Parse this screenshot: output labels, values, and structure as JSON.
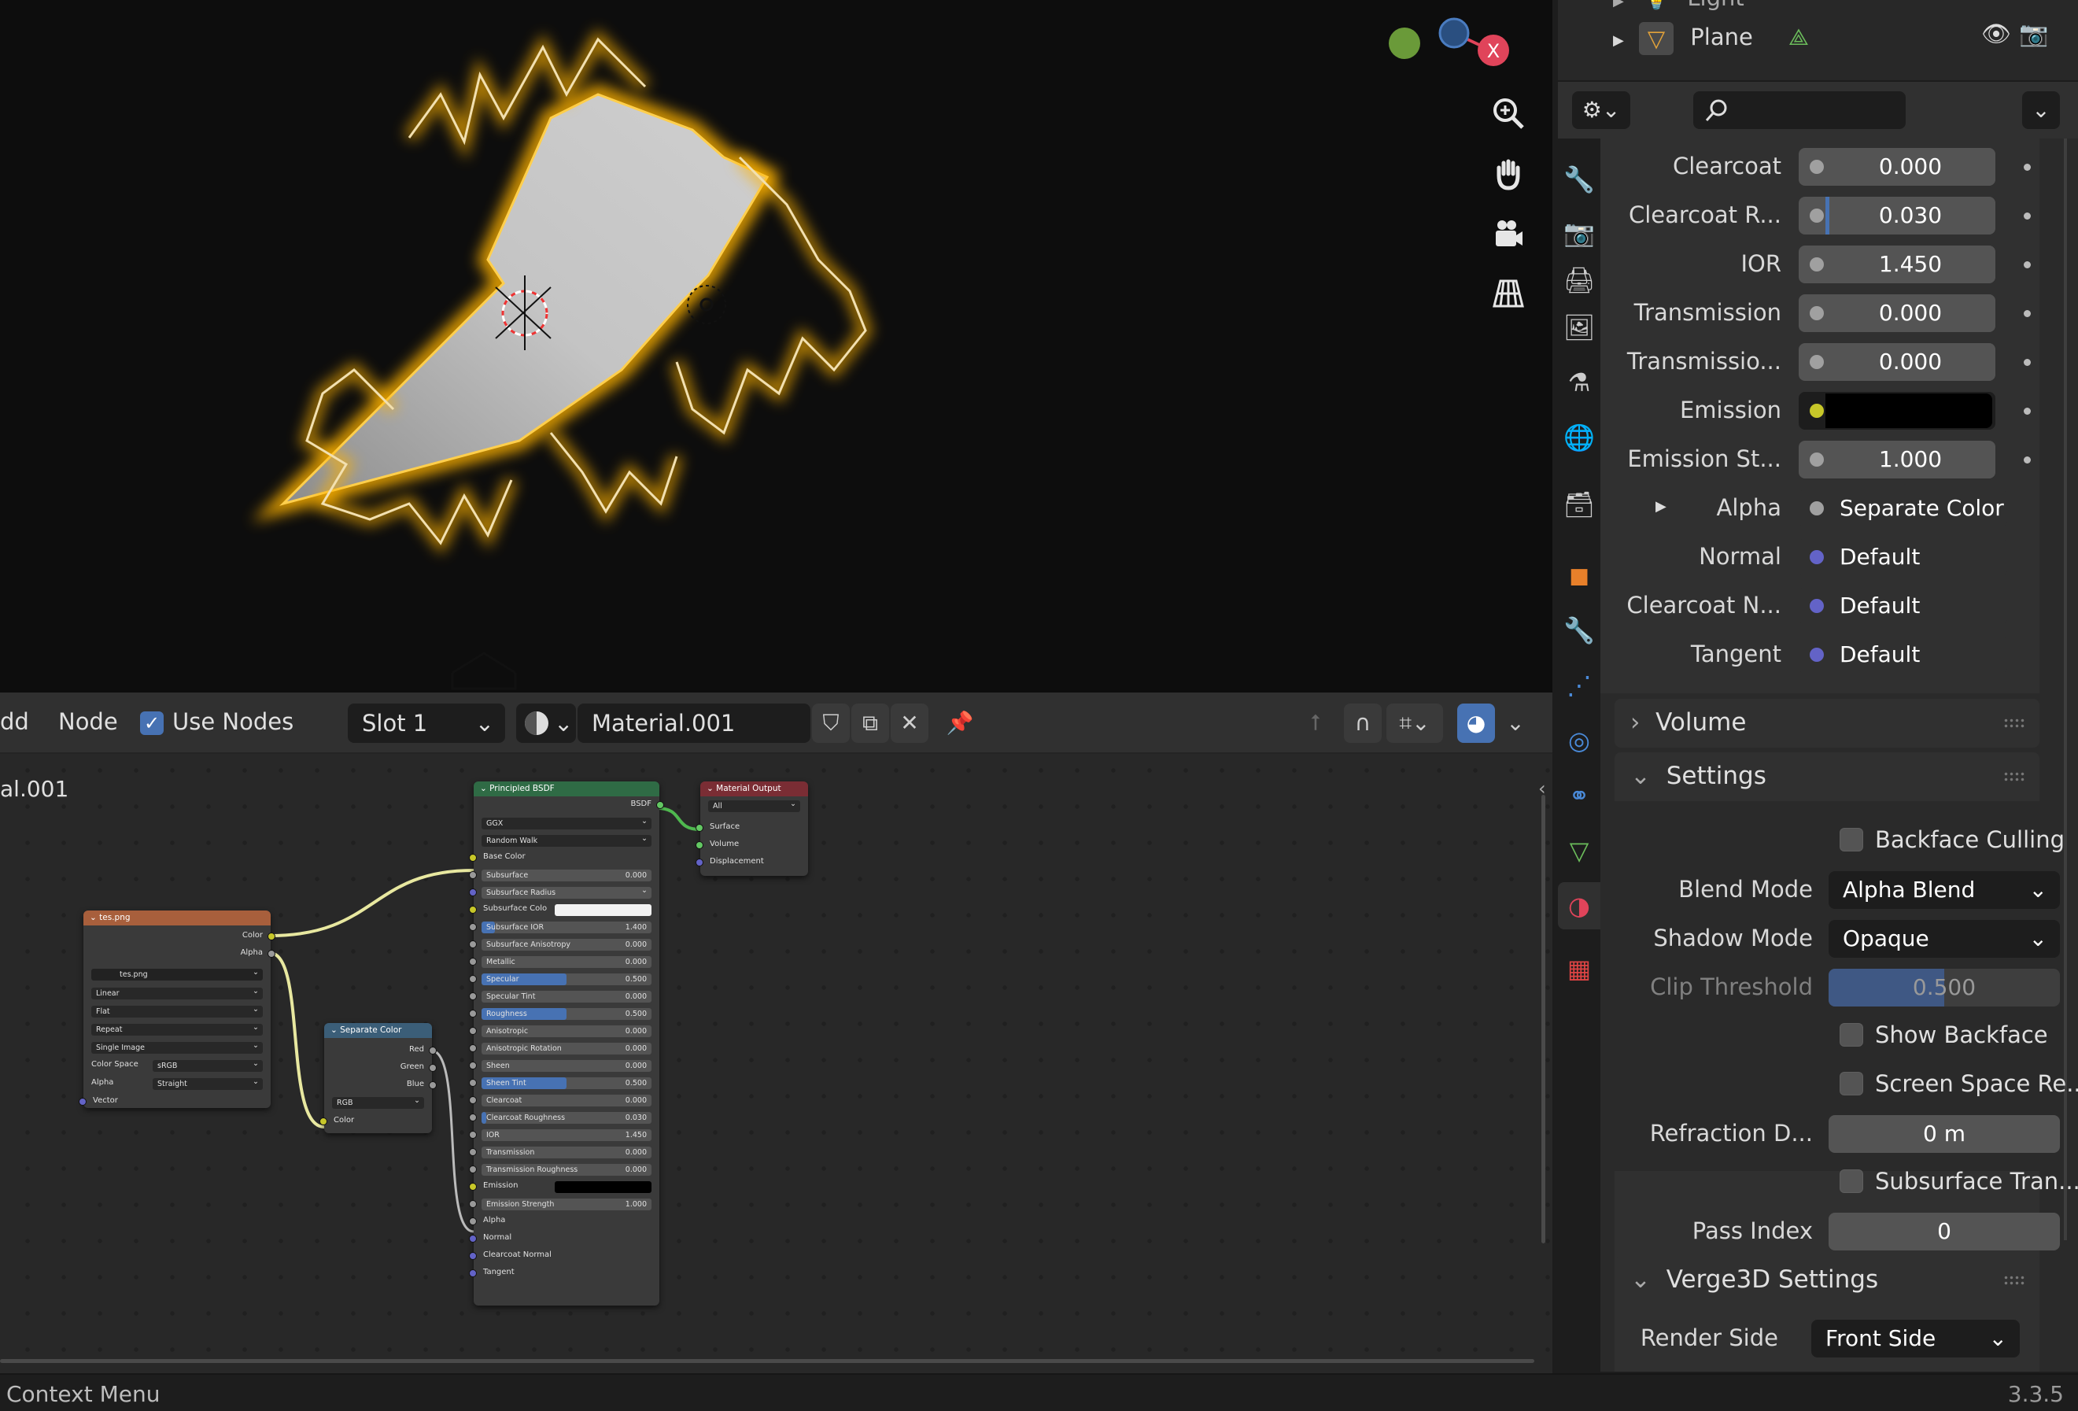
{
  "viewport": {
    "gizmo": {
      "x_label": "X"
    },
    "nav_buttons": [
      "zoom-icon",
      "hand-pan-icon",
      "camera-icon",
      "grid-perspective-icon"
    ]
  },
  "node_editor": {
    "header": {
      "add_menu": "dd",
      "node_menu": "Node",
      "use_nodes_label": "Use Nodes",
      "slot": "Slot 1",
      "material_name": "Material.001"
    },
    "breadcrumb": "al.001",
    "image_node": {
      "title": "tes.png",
      "out_color": "Color",
      "out_alpha": "Alpha",
      "image_name": "tes.png",
      "interpolation": "Linear",
      "projection": "Flat",
      "extension": "Repeat",
      "source": "Single Image",
      "color_space_label": "Color Space",
      "color_space": "sRGB",
      "alpha_label": "Alpha",
      "alpha_mode": "Straight",
      "in_vector": "Vector"
    },
    "separate_node": {
      "title": "Separate Color",
      "out_red": "Red",
      "out_green": "Green",
      "out_blue": "Blue",
      "mode": "RGB",
      "in_color": "Color"
    },
    "bsdf_node": {
      "title": "Principled BSDF",
      "out_bsdf": "BSDF",
      "distribution": "GGX",
      "subsurface_method": "Random Walk",
      "base_color": "Base Color",
      "subsurface": {
        "label": "Subsurface",
        "value": "0.000"
      },
      "subsurface_radius": "Subsurface Radius",
      "subsurface_color": "Subsurface Colo",
      "subsurface_ior": {
        "label": "Subsurface IOR",
        "value": "1.400"
      },
      "subsurface_anisotropy": {
        "label": "Subsurface Anisotropy",
        "value": "0.000"
      },
      "metallic": {
        "label": "Metallic",
        "value": "0.000"
      },
      "specular": {
        "label": "Specular",
        "value": "0.500"
      },
      "specular_tint": {
        "label": "Specular Tint",
        "value": "0.000"
      },
      "roughness": {
        "label": "Roughness",
        "value": "0.500"
      },
      "anisotropic": {
        "label": "Anisotropic",
        "value": "0.000"
      },
      "anisotropic_rotation": {
        "label": "Anisotropic Rotation",
        "value": "0.000"
      },
      "sheen": {
        "label": "Sheen",
        "value": "0.000"
      },
      "sheen_tint": {
        "label": "Sheen Tint",
        "value": "0.500"
      },
      "clearcoat": {
        "label": "Clearcoat",
        "value": "0.000"
      },
      "clearcoat_roughness": {
        "label": "Clearcoat Roughness",
        "value": "0.030"
      },
      "ior": {
        "label": "IOR",
        "value": "1.450"
      },
      "transmission": {
        "label": "Transmission",
        "value": "0.000"
      },
      "transmission_roughness": {
        "label": "Transmission Roughness",
        "value": "0.000"
      },
      "emission": "Emission",
      "emission_strength": {
        "label": "Emission Strength",
        "value": "1.000"
      },
      "alpha": "Alpha",
      "normal": "Normal",
      "clearcoat_normal": "Clearcoat Normal",
      "tangent": "Tangent"
    },
    "output_node": {
      "title": "Material Output",
      "target": "All",
      "surface": "Surface",
      "volume": "Volume",
      "displacement": "Displacement"
    }
  },
  "status_bar": {
    "left": "Context Menu",
    "version": "3.3.5"
  },
  "outliner": {
    "items": [
      {
        "name": "Light",
        "icon": "light-icon"
      },
      {
        "name": "Plane",
        "icon": "mesh-icon"
      }
    ]
  },
  "properties": {
    "search_placeholder": "",
    "rows": [
      {
        "label": "Clearcoat",
        "value": "0.000"
      },
      {
        "label": "Clearcoat R...",
        "value": "0.030"
      },
      {
        "label": "IOR",
        "value": "1.450"
      },
      {
        "label": "Transmission",
        "value": "0.000"
      },
      {
        "label": "Transmissio...",
        "value": "0.000"
      },
      {
        "label": "Emission",
        "value": ""
      },
      {
        "label": "Emission St...",
        "value": "1.000"
      },
      {
        "label": "Alpha",
        "value": "Separate Color"
      },
      {
        "label": "Normal",
        "value": "Default"
      },
      {
        "label": "Clearcoat N...",
        "value": "Default"
      },
      {
        "label": "Tangent",
        "value": "Default"
      }
    ],
    "volume_panel": "Volume",
    "settings_panel": {
      "title": "Settings",
      "backface_culling": "Backface Culling",
      "blend_mode_label": "Blend Mode",
      "blend_mode": "Alpha Blend",
      "shadow_mode_label": "Shadow Mode",
      "shadow_mode": "Opaque",
      "clip_threshold_label": "Clip Threshold",
      "clip_threshold": "0.500",
      "show_backface": "Show Backface",
      "screen_space": "Screen Space Re...",
      "refraction_label": "Refraction D...",
      "refraction": "0 m",
      "subsurface_tran": "Subsurface Tran...",
      "pass_index_label": "Pass Index",
      "pass_index": "0"
    },
    "verge_panel": {
      "title": "Verge3D Settings",
      "render_side_label": "Render Side",
      "render_side": "Front Side"
    }
  },
  "colors": {
    "accent": "#4772b3",
    "bsdf_header": "#2f6b45",
    "output_header": "#7a2d34",
    "image_header": "#a85f3c",
    "separate_header": "#3b5e78"
  }
}
